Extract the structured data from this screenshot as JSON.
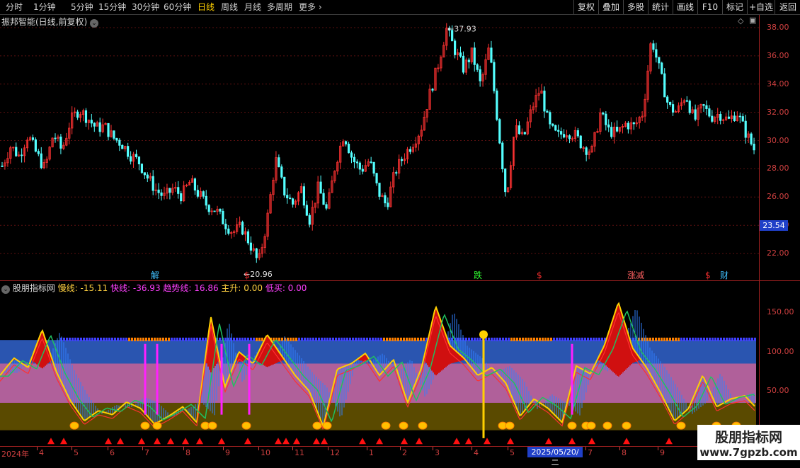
{
  "toolbar": {
    "periods": [
      {
        "label": "分时",
        "active": false
      },
      {
        "label": "1分钟",
        "active": false
      },
      {
        "label": "5分钟",
        "active": false
      },
      {
        "label": "15分钟",
        "active": false
      },
      {
        "label": "30分钟",
        "active": false
      },
      {
        "label": "60分钟",
        "active": false
      },
      {
        "label": "日线",
        "active": true
      },
      {
        "label": "周线",
        "active": false
      },
      {
        "label": "月线",
        "active": false
      },
      {
        "label": "多周期",
        "active": false
      }
    ],
    "more_label": "更多",
    "right_buttons": [
      "复权",
      "叠加",
      "多股",
      "统计",
      "画线",
      "F10",
      "标记",
      "+自选",
      "返回"
    ]
  },
  "main_chart": {
    "title": "振邦智能(日线,前复权)",
    "price_levels": [
      "38.00",
      "36.00",
      "34.00",
      "32.00",
      "30.00",
      "28.00",
      "26.00",
      "24.00",
      "22.00"
    ],
    "current_price": "23.54",
    "high_label": "37.93",
    "low_label": "20.96",
    "events": [
      {
        "label": "解",
        "color": "#40c0ff"
      },
      {
        "label": "$",
        "color": "#ff3030"
      },
      {
        "label": "跌",
        "color": "#30ff30"
      },
      {
        "label": "$",
        "color": "#ff3030"
      },
      {
        "label": "涨减",
        "color": "#ff6060"
      },
      {
        "label": "$",
        "color": "#ff3030"
      },
      {
        "label": "财",
        "color": "#40c0ff"
      }
    ],
    "chart_data": {
      "type": "candlestick",
      "ylim": [
        20.5,
        38.5
      ],
      "high": 37.93,
      "low": 20.96,
      "last": 23.54,
      "close_path": [
        28.2,
        29.6,
        28.9,
        30.4,
        29.1,
        28.0,
        30.5,
        29.3,
        31.4,
        32.2,
        31.6,
        30.9,
        31.0,
        30.2,
        29.8,
        29.0,
        28.5,
        27.4,
        26.5,
        26.0,
        26.6,
        26.1,
        27.1,
        26.2,
        25.4,
        25.1,
        24.2,
        23.5,
        23.9,
        22.7,
        21.3,
        24.3,
        28.7,
        26.4,
        25.5,
        26.6,
        24.4,
        26.7,
        25.0,
        28.3,
        30.5,
        28.7,
        27.9,
        28.6,
        26.4,
        25.4,
        27.8,
        28.9,
        29.8,
        30.8,
        33.2,
        35.3,
        37.93,
        36.4,
        35.1,
        36.2,
        33.9,
        36.6,
        31.3,
        25.9,
        30.9,
        30.1,
        32.3,
        33.7,
        31.0,
        30.3,
        30.7,
        30.4,
        29.6,
        29.2,
        31.9,
        30.7,
        30.5,
        31.2,
        31.0,
        32.0,
        37.3,
        34.8,
        32.4,
        32.0,
        33.3,
        31.4,
        32.4,
        31.7,
        31.9,
        31.4,
        32.0,
        30.6,
        29.4
      ]
    }
  },
  "indicator": {
    "name": "股朋指标网",
    "labels": [
      {
        "text": "慢线: -15.11",
        "color": "#ffd040"
      },
      {
        "text": "快线: -36.93",
        "color": "#ff40ff"
      },
      {
        "text": "趋势线: 16.86",
        "color": "#ff40ff"
      },
      {
        "text": "主升: 0.00",
        "color": "#ffd040"
      },
      {
        "text": "低买: 0.00",
        "color": "#ff40ff"
      }
    ],
    "levels": [
      "150.00",
      "100.00",
      "50.00"
    ],
    "chart_data": {
      "type": "area",
      "bands": [
        {
          "name": "",
          "from": 85,
          "to": 115,
          "color": "#2a55b0"
        },
        {
          "name": "",
          "from": 35,
          "to": 85,
          "color": "#b0609a"
        },
        {
          "name": "",
          "from": 0,
          "to": 35,
          "color": "#5a4a00"
        }
      ],
      "ylim": [
        -20,
        190
      ],
      "curve": [
        70,
        92,
        80,
        128,
        75,
        38,
        12,
        25,
        20,
        36,
        28,
        8,
        18,
        30,
        10,
        145,
        55,
        100,
        85,
        122,
        96,
        70,
        50,
        5,
        78,
        85,
        98,
        70,
        90,
        35,
        80,
        158,
        108,
        92,
        70,
        80,
        60,
        18,
        40,
        28,
        10,
        82,
        72,
        108,
        163,
        105,
        80,
        48,
        12,
        28,
        70,
        30,
        40,
        44,
        25
      ]
    }
  },
  "x_axis": {
    "labels": [
      "2024年",
      "4",
      "5",
      "6",
      "7",
      "8",
      "9",
      "10",
      "11",
      "12",
      "1",
      "2",
      "3",
      "4",
      "5",
      "6",
      "7",
      "8",
      "9"
    ],
    "date_tip": "2025/05/20/二"
  },
  "watermark": {
    "title": "股朋指标网",
    "url": "www.7gpzb.com"
  }
}
